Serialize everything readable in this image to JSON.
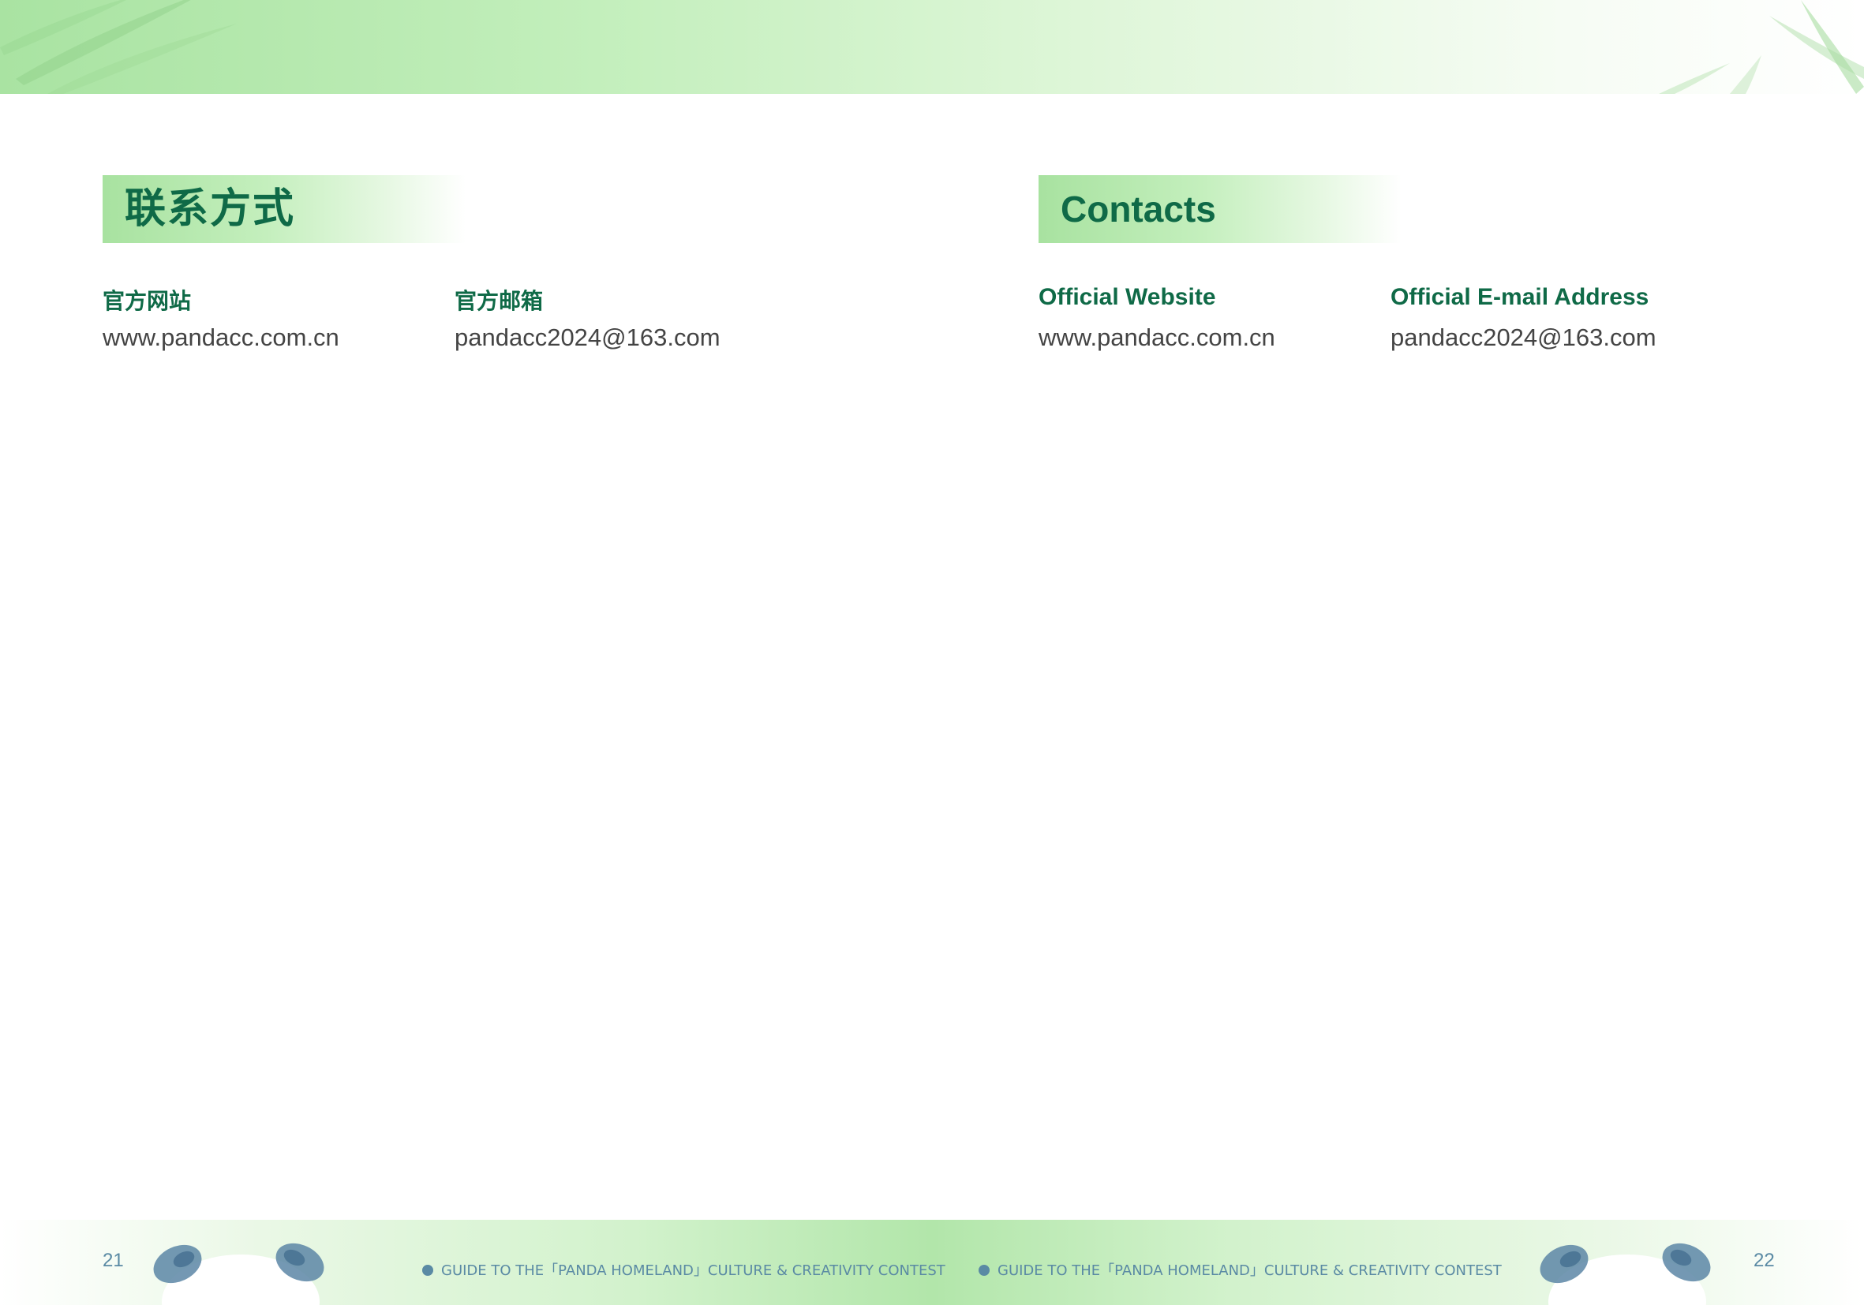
{
  "left": {
    "title": "联系方式",
    "website_label": "官方网站",
    "website_value": "www.pandacc.com.cn",
    "email_label": "官方邮箱",
    "email_value": "pandacc2024@163.com"
  },
  "right": {
    "title": "Contacts",
    "website_label": "Official Website",
    "website_value": "www.pandacc.com.cn",
    "email_label": "Official E-mail Address",
    "email_value": "pandacc2024@163.com"
  },
  "footer": {
    "page_left": "21",
    "page_right": "22",
    "text_left": "GUIDE TO THE「PANDA HOMELAND」CULTURE & CREATIVITY CONTEST",
    "text_right": "GUIDE TO THE「PANDA HOMELAND」CULTURE & CREATIVITY CONTEST"
  },
  "colors": {
    "accent_green": "#0f6a47",
    "band_green": "#b2e6aa",
    "footer_blue": "#5a8aa4"
  }
}
